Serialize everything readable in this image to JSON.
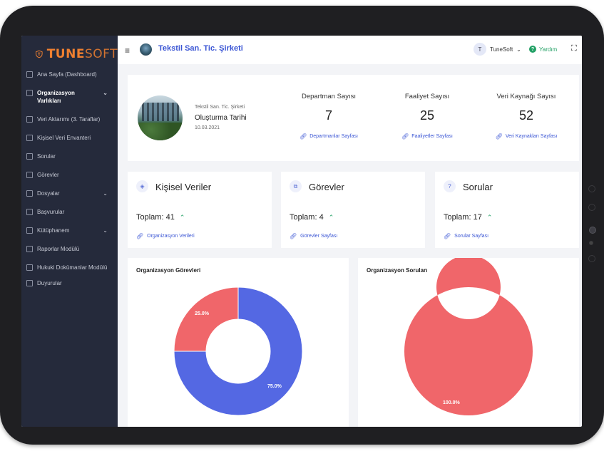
{
  "brand": {
    "part1": "TUNE",
    "part2": "SOFT",
    "color": "#f08030"
  },
  "sidebar": {
    "items": [
      {
        "label": "Ana Sayfa (Dashboard)",
        "icon": "dashboard-icon",
        "active": false,
        "chevron": ""
      },
      {
        "label": "Organizasyon Varlıkları",
        "icon": "building-icon",
        "active": true,
        "chevron": "⌄"
      },
      {
        "label": "Veri Aktarımı (3. Taraflar)",
        "icon": "transfer-icon",
        "active": false,
        "chevron": ""
      },
      {
        "label": "Kişisel Veri Envanteri",
        "icon": "table-icon",
        "active": false,
        "chevron": ""
      },
      {
        "label": "Sorular",
        "icon": "question-icon",
        "active": false,
        "chevron": ""
      },
      {
        "label": "Görevler",
        "icon": "clipboard-icon",
        "active": false,
        "chevron": ""
      },
      {
        "label": "Dosyalar",
        "icon": "folder-icon",
        "active": false,
        "chevron": "⌄"
      },
      {
        "label": "Başvurular",
        "icon": "application-icon",
        "active": false,
        "chevron": ""
      },
      {
        "label": "Kütüphanem",
        "icon": "library-icon",
        "active": false,
        "chevron": "⌄"
      },
      {
        "label": "Raporlar Modülü",
        "icon": "report-icon",
        "active": false,
        "chevron": ""
      },
      {
        "label": "Hukuki Dokümanlar Modülü",
        "icon": "document-icon",
        "active": false,
        "chevron": ""
      },
      {
        "label": "Duyurular",
        "icon": "announcement-icon",
        "active": false,
        "chevron": ""
      }
    ]
  },
  "topbar": {
    "menu_icon": "≡",
    "company_name": "Tekstil San. Tic. Şirketi",
    "user_initial": "T",
    "user_name": "TuneSoft",
    "user_chevron": "⌄",
    "help_label": "Yardım",
    "fullscreen_icon": "⛶"
  },
  "company_card": {
    "small_name": "Tekstil San. Tic. Şirketi",
    "created_label": "Oluşturma Tarihi",
    "created_date": "10.03.2021",
    "stats": [
      {
        "label": "Departman Sayısı",
        "value": "7",
        "link": "Departmanlar Sayfası"
      },
      {
        "label": "Faaliyet Sayısı",
        "value": "25",
        "link": "Faaliyetler Sayfası"
      },
      {
        "label": "Veri Kaynağı Sayısı",
        "value": "52",
        "link": "Veri Kaynakları Sayfası"
      }
    ]
  },
  "mini_cards": [
    {
      "title": "Kişisel Veriler",
      "icon": "tag-icon",
      "total": "Toplam: 41",
      "link": "Organizasyon Verileri"
    },
    {
      "title": "Görevler",
      "icon": "tasks-icon",
      "total": "Toplam: 4",
      "link": "Görevler Sayfası"
    },
    {
      "title": "Sorular",
      "icon": "question-icon",
      "total": "Toplam: 17",
      "link": "Sorular Sayfası"
    }
  ],
  "chart_data": [
    {
      "type": "pie",
      "title": "Organizasyon Görevleri",
      "donut": true,
      "slices": [
        {
          "label": "75.0%",
          "value": 75.0,
          "color": "#5468e3"
        },
        {
          "label": "25.0%",
          "value": 25.0,
          "color": "#f0666a"
        }
      ]
    },
    {
      "type": "pie",
      "title": "Organizasyon Soruları",
      "donut": true,
      "slices": [
        {
          "label": "100.0%",
          "value": 100.0,
          "color": "#f0666a"
        }
      ]
    }
  ],
  "colors": {
    "accent": "#3a55d4",
    "sidebar_bg": "#252a3b",
    "success": "#22a065"
  }
}
